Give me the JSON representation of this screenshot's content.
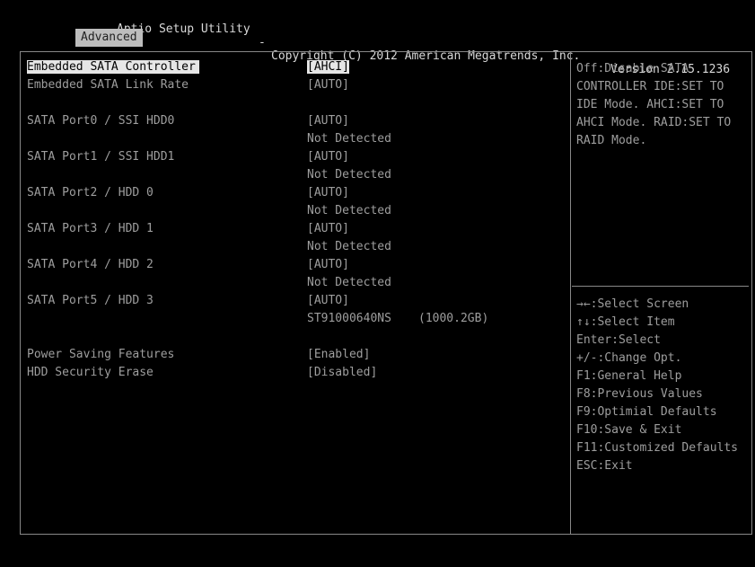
{
  "header": {
    "app_title": "Aptio Setup Utility",
    "copyright": "Copyright (C) 2012 American Megatrends, Inc.",
    "version": "Version 2.15.1236",
    "active_tab": "Advanced"
  },
  "settings": [
    {
      "label": "Embedded SATA Controller",
      "value": "[AHCI]",
      "selected": true
    },
    {
      "label": "Embedded SATA Link Rate",
      "value": "[AUTO]"
    },
    {
      "label": "SATA Port0 / SSI HDD0",
      "value": "[AUTO]",
      "status": "Not Detected"
    },
    {
      "label": "SATA Port1 / SSI HDD1",
      "value": "[AUTO]",
      "status": "Not Detected"
    },
    {
      "label": "SATA Port2 / HDD 0",
      "value": "[AUTO]",
      "status": "Not Detected"
    },
    {
      "label": "SATA Port3 / HDD 1",
      "value": "[AUTO]",
      "status": "Not Detected"
    },
    {
      "label": "SATA Port4 / HDD 2",
      "value": "[AUTO]",
      "status": "Not Detected"
    },
    {
      "label": "SATA Port5 / HDD 3",
      "value": "[AUTO]",
      "device": "ST91000640NS",
      "capacity": "(1000.2GB)"
    },
    {
      "label": "Power Saving Features",
      "value": "[Enabled]"
    },
    {
      "label": "HDD Security Erase",
      "value": "[Disabled]"
    }
  ],
  "help": {
    "description": "Off:Disable SATA CONTROLLER IDE:SET TO IDE Mode. AHCI:SET TO AHCI Mode. RAID:SET TO RAID Mode.",
    "keys": [
      "→←:Select Screen",
      "↑↓:Select Item",
      "Enter:Select",
      "+/-:Change Opt.",
      "F1:General Help",
      "F8:Previous Values",
      "F9:Optimial Defaults",
      "F10:Save & Exit",
      "F11:Customized Defaults",
      "ESC:Exit"
    ]
  },
  "colors": {
    "background": "#000000",
    "text": "#9e9e9e",
    "highlight": "#e6e6e6"
  }
}
